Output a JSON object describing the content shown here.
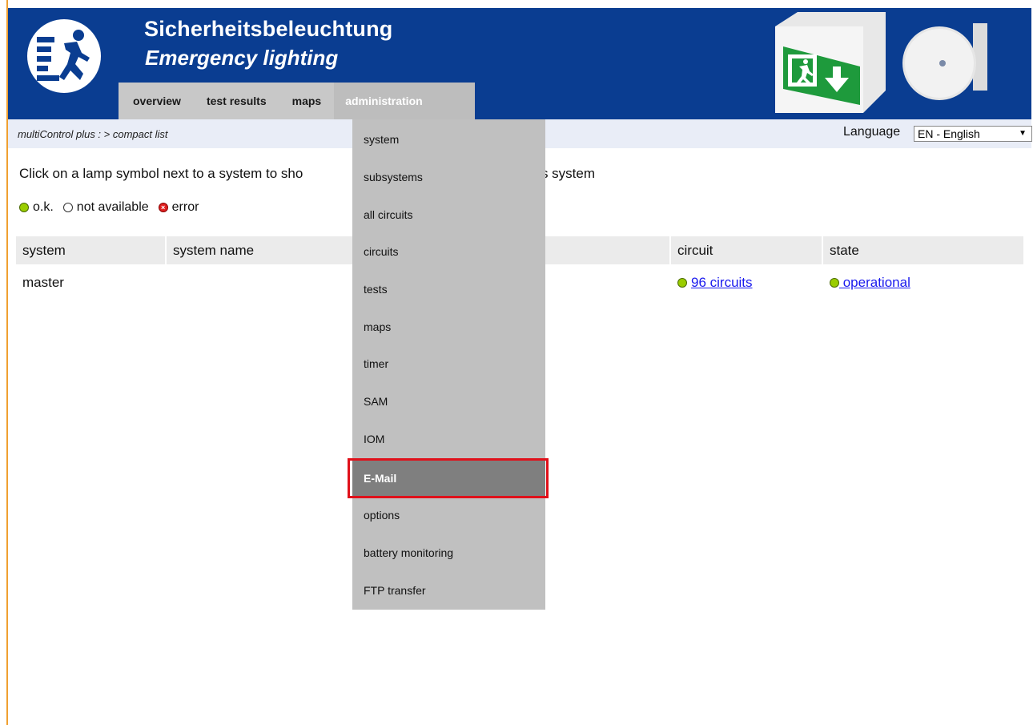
{
  "header": {
    "title_main": "Sicherheitsbeleuchtung",
    "title_sub": "Emergency lighting",
    "brand_color": "#0a3d91",
    "logo_icon": "emergency-exit-running-man-icon",
    "product_images": [
      "exit-sign-icon",
      "round-emergency-lamp-icon"
    ]
  },
  "nav": {
    "items": [
      {
        "label": "overview",
        "active": false
      },
      {
        "label": "test results",
        "active": false
      },
      {
        "label": "maps",
        "active": false
      },
      {
        "label": "administration",
        "active": true
      }
    ]
  },
  "breadcrumb": {
    "text": "multiControl plus : > compact list"
  },
  "language": {
    "label": "Language",
    "selected": "EN - English"
  },
  "instruction": {
    "text_before": "Click on a lamp symbol next to a system to sho",
    "text_after": "tion for this system"
  },
  "legend": {
    "ok": "o.k.",
    "not_available": "not available",
    "error": "error"
  },
  "table": {
    "columns": [
      "system",
      "system name",
      "circuit",
      "state"
    ],
    "rows": [
      {
        "system": "master",
        "system_name": "",
        "circuit": "96 circuits",
        "state": " operational"
      }
    ]
  },
  "dropdown": {
    "items": [
      "system",
      "subsystems",
      "all circuits",
      "circuits",
      "tests",
      "maps",
      "timer",
      "SAM",
      "IOM",
      "E-Mail",
      "options",
      "battery monitoring",
      "FTP transfer"
    ],
    "highlighted": "E-Mail",
    "highlight_color": "#e0101a"
  }
}
